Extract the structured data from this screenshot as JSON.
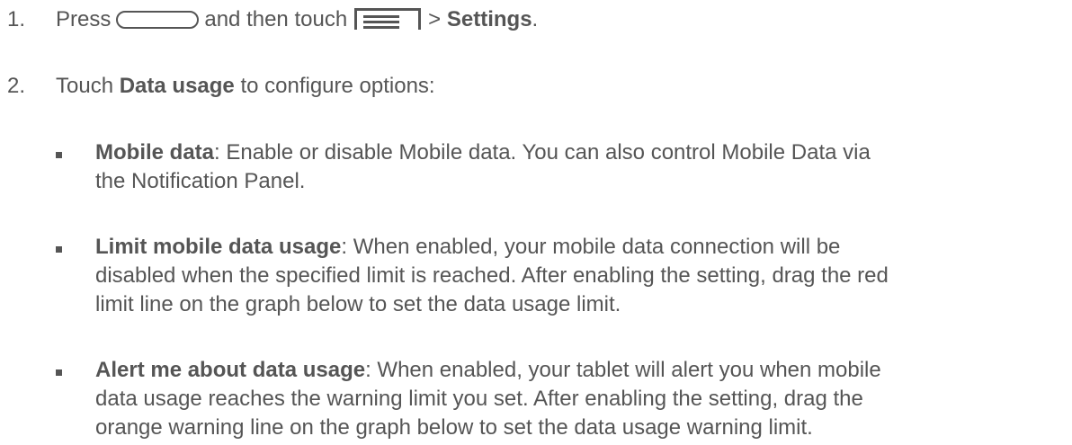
{
  "steps": [
    {
      "num": "1.",
      "press": "Press",
      "and_then": "and then touch",
      "sep": ">",
      "settings": "Settings",
      "end": "."
    },
    {
      "num": "2.",
      "touch": "Touch",
      "data_usage": "Data usage",
      "rest": "to configure options:"
    }
  ],
  "options": [
    {
      "title": "Mobile data",
      "lines": [
        ": Enable or disable Mobile data. You can also control Mobile Data via",
        "the Notification Panel."
      ]
    },
    {
      "title": "Limit mobile data usage",
      "lines": [
        ": When enabled, your mobile data connection will be",
        "disabled when the specified limit is reached. After enabling the setting, drag the red",
        "limit line on the graph below to set the data usage limit."
      ]
    },
    {
      "title": "Alert me about data usage",
      "lines": [
        ": When enabled, your tablet will alert you when mobile",
        "data usage reaches the warning limit you set. After enabling the setting, drag the",
        "orange warning line on the graph below to set the data usage warning limit."
      ]
    }
  ],
  "icons": {
    "home_key": "home-key-icon",
    "menu_key": "menu-key-icon"
  },
  "colors": {
    "text": "#555555"
  }
}
